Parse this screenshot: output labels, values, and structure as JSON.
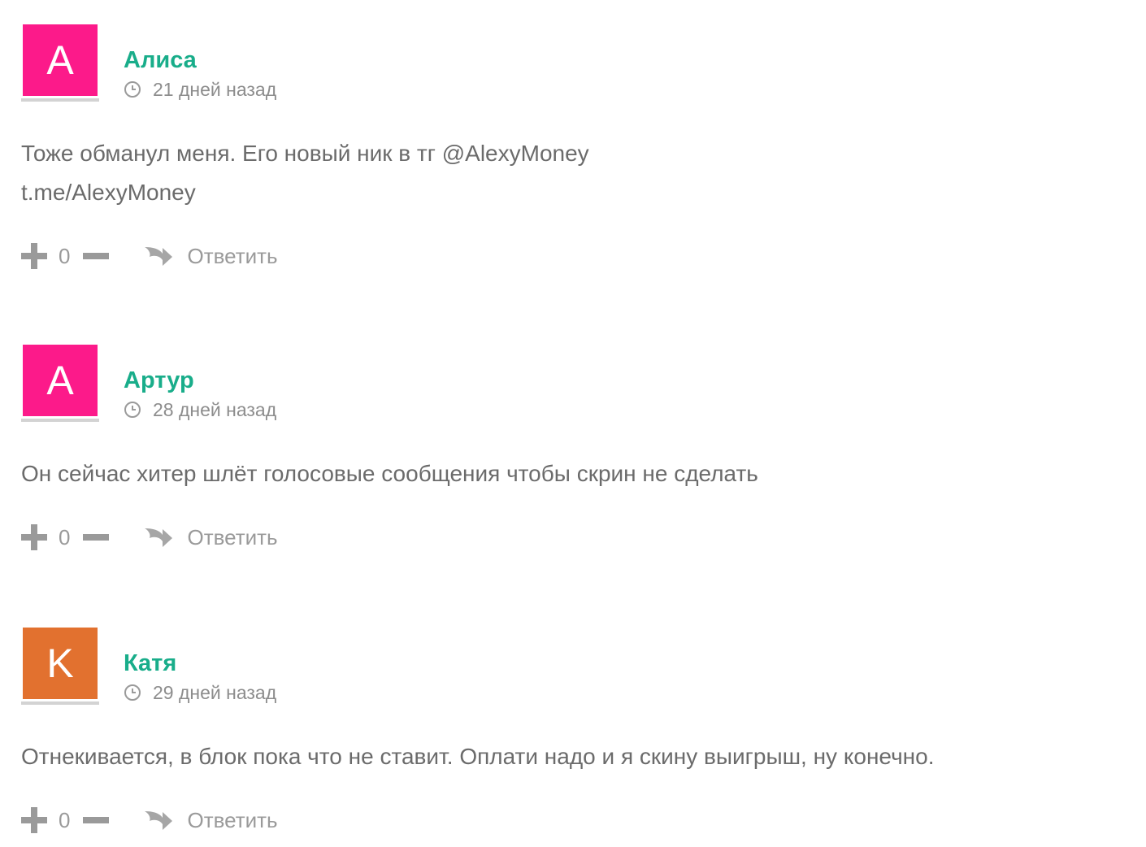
{
  "comments": [
    {
      "avatar_letter": "A",
      "avatar_color": "#fc1a8a",
      "author": "Алиса",
      "time": "21 дней назад",
      "lines": [
        "Тоже обманул меня. Его новый ник в тг @AlexyMoney",
        "t.me/AlexyMoney"
      ],
      "votes": "0",
      "reply_label": "Ответить"
    },
    {
      "avatar_letter": "A",
      "avatar_color": "#fc1a8a",
      "author": "Артур",
      "time": "28 дней назад",
      "lines": [
        "Он сейчас хитер шлёт голосовые сообщения чтобы скрин не сделать"
      ],
      "votes": "0",
      "reply_label": "Ответить"
    },
    {
      "avatar_letter": "K",
      "avatar_color": "#e2712f",
      "author": "Катя",
      "time": "29 дней назад",
      "lines": [
        "Отнекивается, в блок пока что не ставит. Оплати надо и я скину выигрыш, ну конечно."
      ],
      "votes": "0",
      "reply_label": "Ответить"
    }
  ],
  "colors": {
    "author": "#19ad8a",
    "text": "#6b6b6b",
    "muted": "#9a9a9a"
  }
}
